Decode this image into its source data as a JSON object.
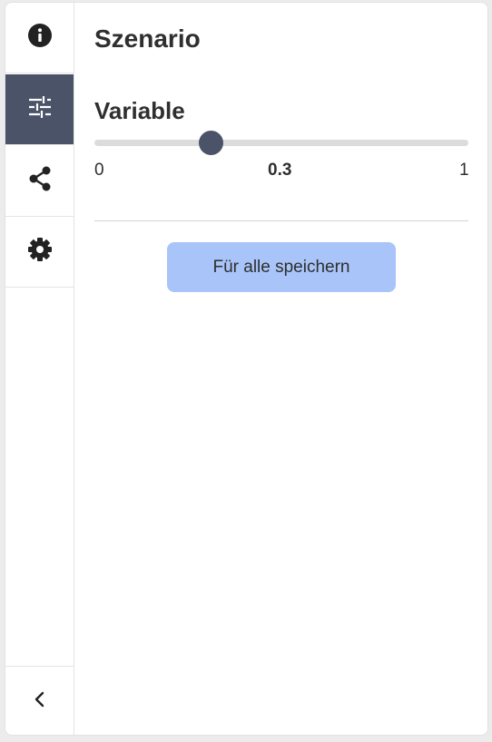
{
  "sidebar": {
    "items": [
      {
        "icon": "info-icon"
      },
      {
        "icon": "sliders-icon",
        "active": true
      },
      {
        "icon": "share-icon"
      },
      {
        "icon": "gear-icon"
      }
    ],
    "collapse_icon": "chevron-left-icon"
  },
  "main": {
    "title": "Szenario",
    "variable": {
      "label": "Variable",
      "min": "0",
      "value": "0.3",
      "max": "1"
    },
    "save_button": "Für alle speichern"
  },
  "colors": {
    "accent": "#4a5368",
    "button": "#a8c4f8",
    "track": "#dcdcdc"
  }
}
